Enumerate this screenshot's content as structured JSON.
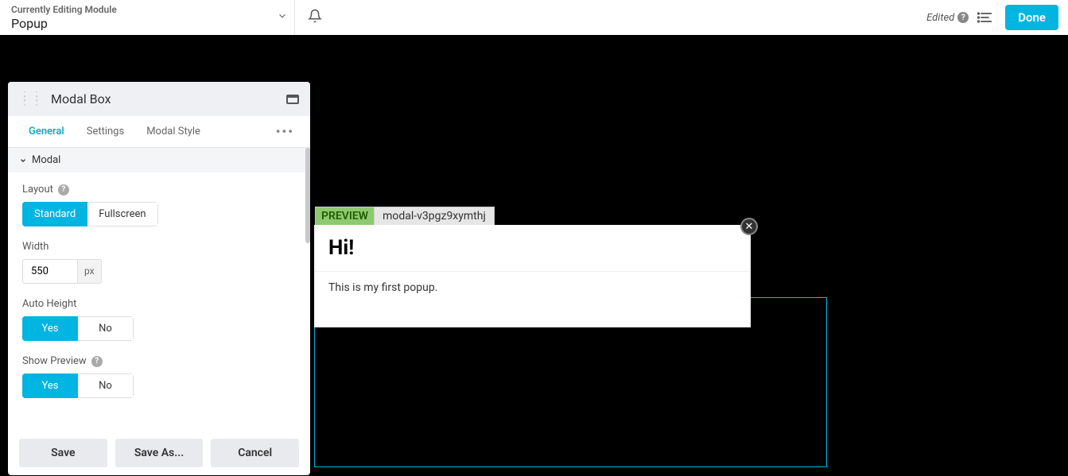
{
  "header": {
    "module_label": "Currently Editing Module",
    "module_name": "Popup",
    "edited": "Edited",
    "done": "Done"
  },
  "panel": {
    "title": "Modal Box",
    "tabs": {
      "general": "General",
      "settings": "Settings",
      "modal_style": "Modal Style"
    },
    "section": "Modal",
    "fields": {
      "layout_label": "Layout",
      "layout_standard": "Standard",
      "layout_fullscreen": "Fullscreen",
      "width_label": "Width",
      "width_value": "550",
      "width_unit": "px",
      "auto_height_label": "Auto Height",
      "yes": "Yes",
      "no": "No",
      "show_preview_label": "Show Preview"
    },
    "buttons": {
      "save": "Save",
      "save_as": "Save As...",
      "cancel": "Cancel"
    }
  },
  "preview": {
    "tag": "PREVIEW",
    "modal_id": "modal-v3pgz9xymthj",
    "heading": "Hi!",
    "body": "This is my first popup."
  }
}
